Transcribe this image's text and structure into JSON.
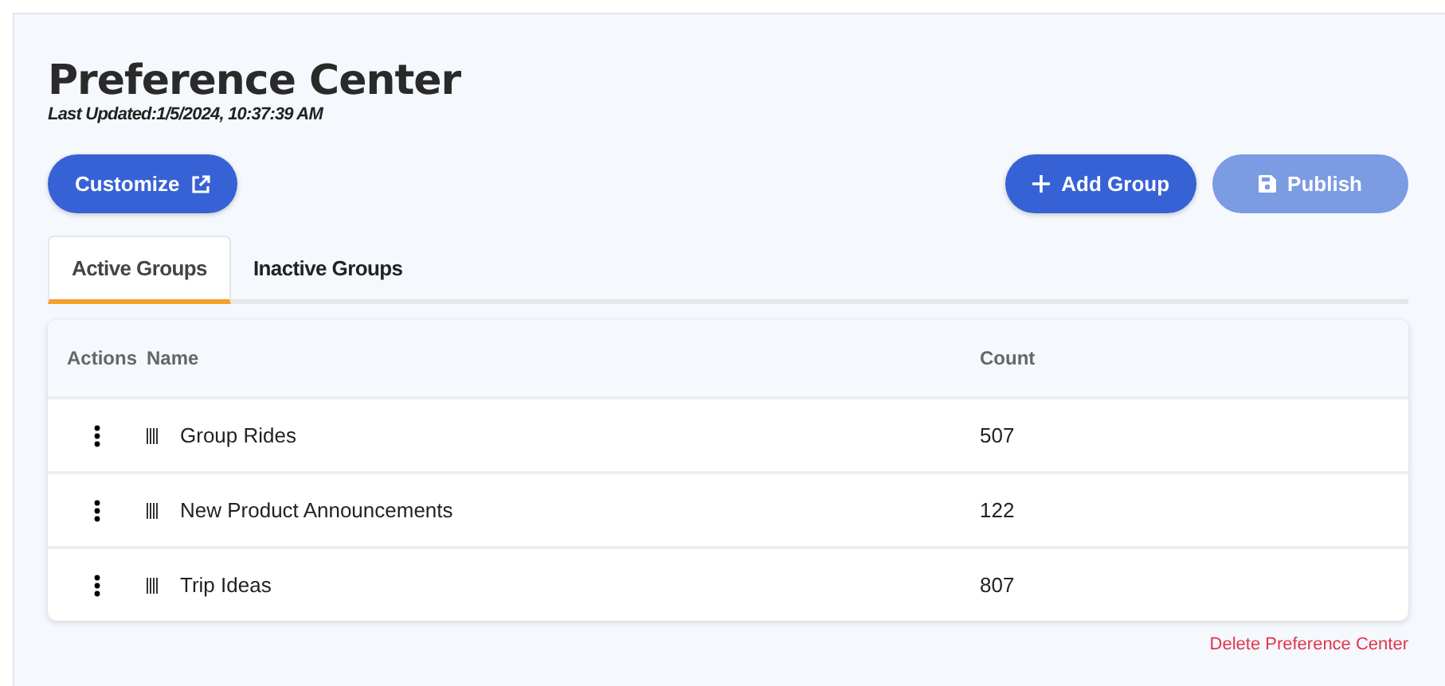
{
  "title": "Preference Center",
  "last_updated": "Last Updated:1/5/2024, 10:37:39 AM",
  "buttons": [
    {
      "label": "Customize",
      "kind": "external",
      "disabled": false
    },
    {
      "label": "Add Group",
      "kind": "add",
      "disabled": false
    },
    {
      "label": "Publish",
      "kind": "save",
      "disabled": true
    }
  ],
  "tabs": [
    {
      "label": "Active Groups",
      "selected": true
    },
    {
      "label": "Inactive Groups",
      "selected": false
    }
  ],
  "table": {
    "columns": [
      "Actions",
      "Name",
      "Count"
    ],
    "rows": [
      {
        "name": "Group Rides",
        "count": "507"
      },
      {
        "name": "New Product Announcements",
        "count": "122"
      },
      {
        "name": "Trip Ideas",
        "count": "807"
      }
    ]
  },
  "delete_link": "Delete Preference Center"
}
